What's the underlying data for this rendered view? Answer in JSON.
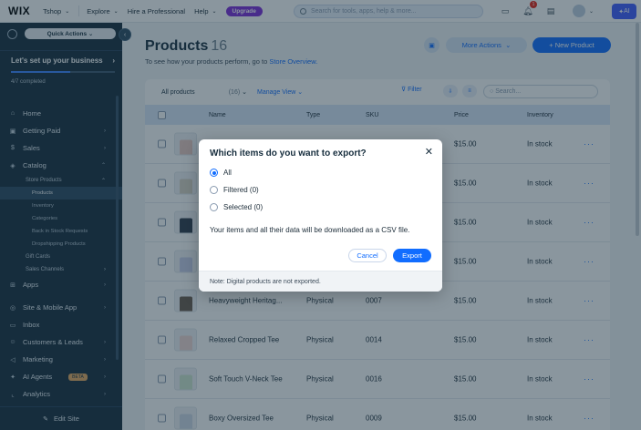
{
  "topbar": {
    "logo": "WIX",
    "nav": [
      {
        "label": "Tshop"
      },
      {
        "label": "Explore"
      },
      {
        "label": "Hire a Professional"
      },
      {
        "label": "Help"
      }
    ],
    "upgrade": "Upgrade",
    "search_placeholder": "Search for tools, apps, help & more...",
    "notification_count": "1",
    "ai_label": "AI"
  },
  "sidebar": {
    "quick_actions": "Quick Actions",
    "setup_title": "Let's set up your business",
    "setup_progress": 0.571,
    "setup_status": "4/7 completed",
    "items": {
      "home": "Home",
      "getting_paid": "Getting Paid",
      "sales": "Sales",
      "catalog": "Catalog",
      "store_products": "Store Products",
      "products": "Products",
      "inventory": "Inventory",
      "categories": "Categories",
      "back_in_stock": "Back in Stock Requests",
      "dropshipping": "Dropshipping Products",
      "gift_cards": "Gift Cards",
      "sales_channels": "Sales Channels",
      "apps": "Apps",
      "site_mobile": "Site & Mobile App",
      "inbox": "Inbox",
      "customers": "Customers & Leads",
      "marketing": "Marketing",
      "ai_agents": "AI Agents",
      "ai_agents_badge": "BETA",
      "analytics": "Analytics"
    },
    "edit_site": "Edit Site"
  },
  "page": {
    "title": "Products",
    "count": "16",
    "subtitle": "To see how your products perform, go to",
    "subtitle_link": "Store Overview.",
    "more_actions": "More Actions",
    "new_product": "+ New Product"
  },
  "toolbar": {
    "filter_select": "All products",
    "filter_count": "(16)",
    "manage_view": "Manage View",
    "filter": "Filter",
    "search_placeholder": "Search..."
  },
  "table": {
    "headers": {
      "name": "Name",
      "type": "Type",
      "sku": "SKU",
      "price": "Price",
      "inventory": "Inventory"
    },
    "rows": [
      {
        "name": "",
        "type": "",
        "sku": "",
        "price": "$15.00",
        "inventory": "In stock",
        "color": "#e9c9c0"
      },
      {
        "name": "",
        "type": "",
        "sku": "",
        "price": "$15.00",
        "inventory": "In stock",
        "color": "#d9d2c5"
      },
      {
        "name": "",
        "type": "",
        "sku": "",
        "price": "$15.00",
        "inventory": "In stock",
        "color": "#2e3a4a"
      },
      {
        "name": "",
        "type": "",
        "sku": "",
        "price": "$15.00",
        "inventory": "In stock",
        "color": "#c7cde8"
      },
      {
        "name": "Heavyweight Heritag...",
        "type": "Physical",
        "sku": "0007",
        "price": "$15.00",
        "inventory": "In stock",
        "color": "#6b5a4c"
      },
      {
        "name": "Relaxed Cropped Tee",
        "type": "Physical",
        "sku": "0014",
        "price": "$15.00",
        "inventory": "In stock",
        "color": "#f1d7d2"
      },
      {
        "name": "Soft Touch V-Neck Tee",
        "type": "Physical",
        "sku": "0016",
        "price": "$15.00",
        "inventory": "In stock",
        "color": "#cfe6cf"
      },
      {
        "name": "Boxy Oversized Tee",
        "type": "Physical",
        "sku": "0009",
        "price": "$15.00",
        "inventory": "In stock",
        "color": "#cfd8e6"
      }
    ]
  },
  "modal": {
    "title": "Which items do you want to export?",
    "options": [
      {
        "label": "All",
        "selected": true
      },
      {
        "label": "Filtered (0)",
        "selected": false
      },
      {
        "label": "Selected (0)",
        "selected": false
      }
    ],
    "info": "Your items and all their data will be downloaded as a CSV file.",
    "cancel": "Cancel",
    "export": "Export",
    "note": "Note: Digital products are not exported."
  },
  "colors": {
    "accent": "#116dff",
    "sidebar_bg": "#162d3d",
    "upgrade": "#7d2bd8",
    "ai_button": "#3f5bff"
  }
}
